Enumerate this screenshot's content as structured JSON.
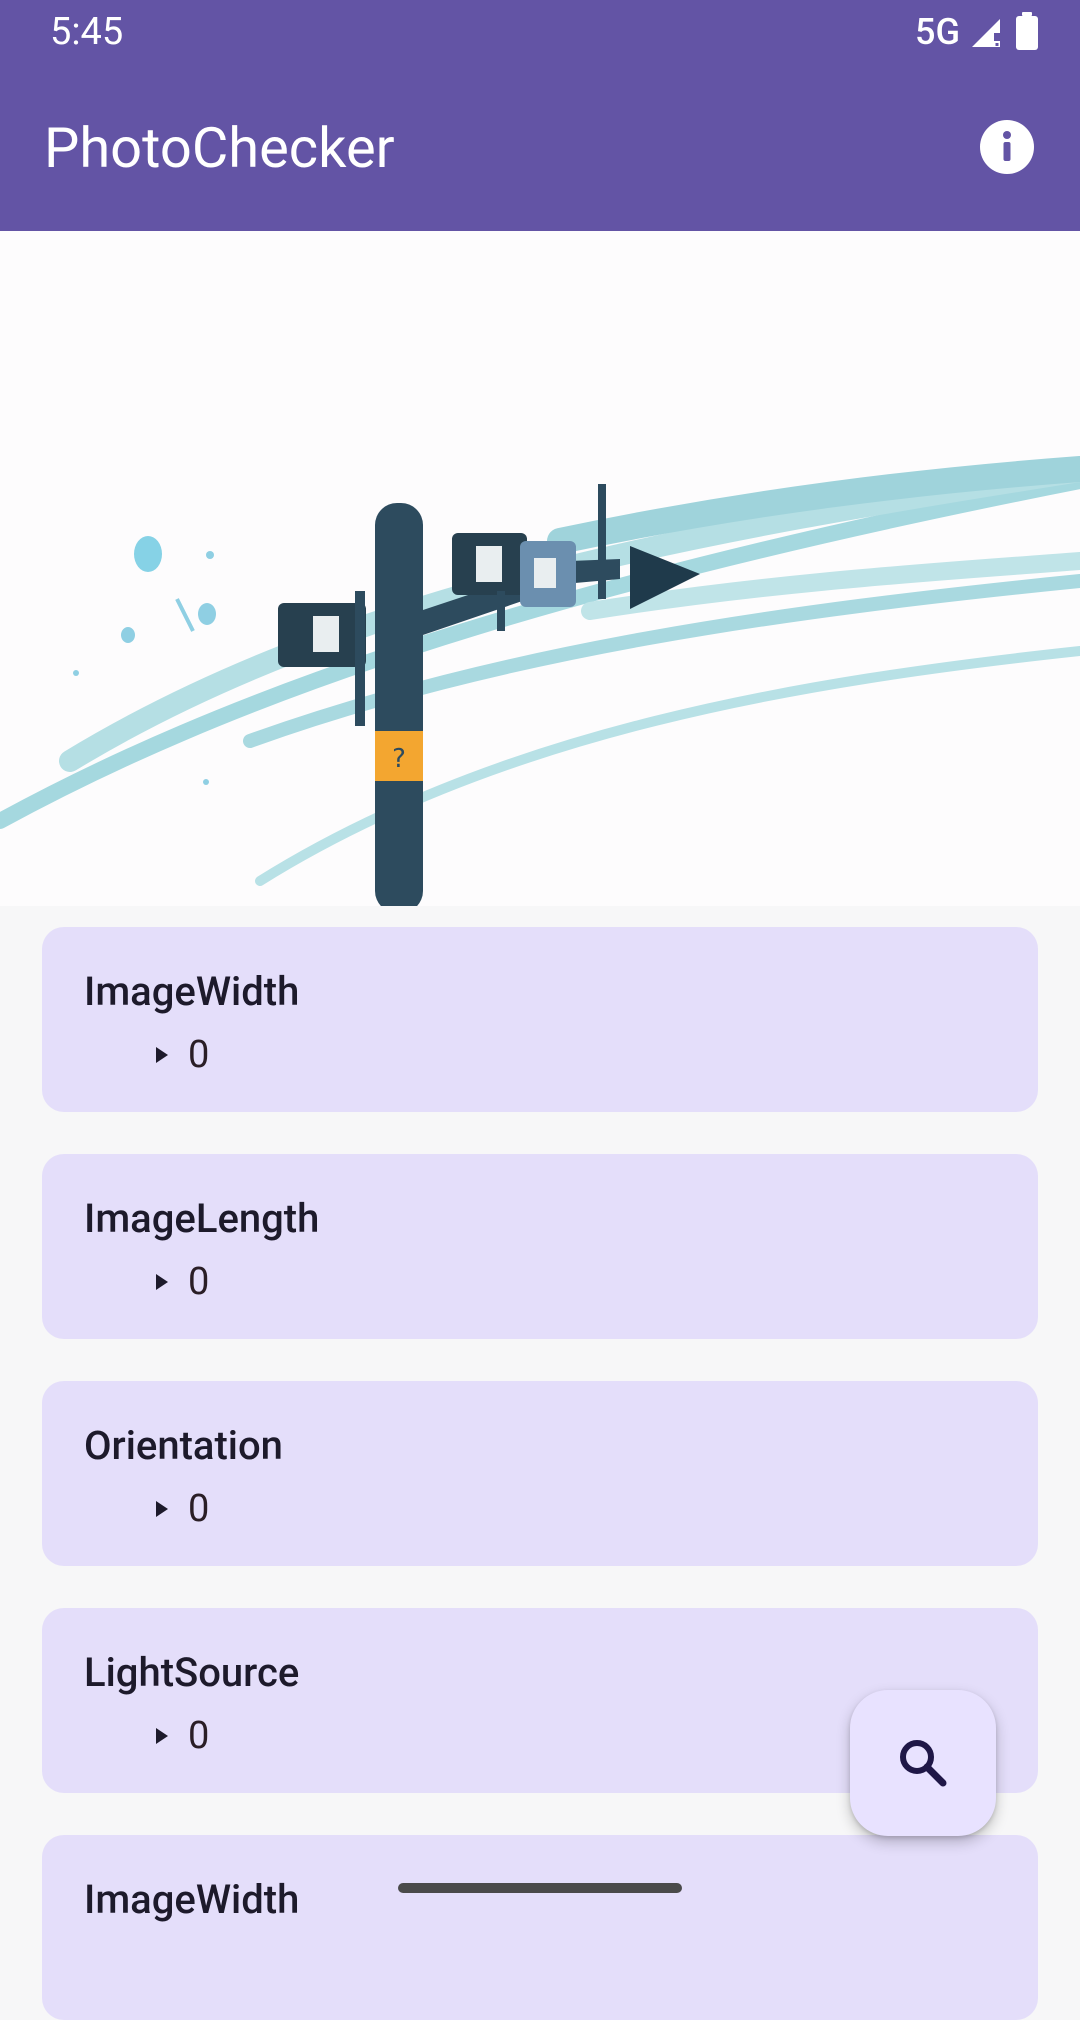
{
  "status_bar": {
    "time": "5:45",
    "network": "5G",
    "icons": [
      "signal-icon",
      "battery-icon"
    ]
  },
  "app_bar": {
    "title": "PhotoChecker",
    "info_icon": "info-icon"
  },
  "hero": {
    "description": "signpost illustration"
  },
  "cards": [
    {
      "title": "ImageWidth",
      "value": "0"
    },
    {
      "title": "ImageLength",
      "value": "0"
    },
    {
      "title": "Orientation",
      "value": "0"
    },
    {
      "title": "LightSource",
      "value": "0"
    },
    {
      "title": "ImageWidth",
      "value": ""
    }
  ],
  "fab": {
    "icon": "search-icon"
  },
  "colors": {
    "primary": "#6354a5",
    "card": "#e4defa",
    "fab": "#e8e2ff"
  }
}
